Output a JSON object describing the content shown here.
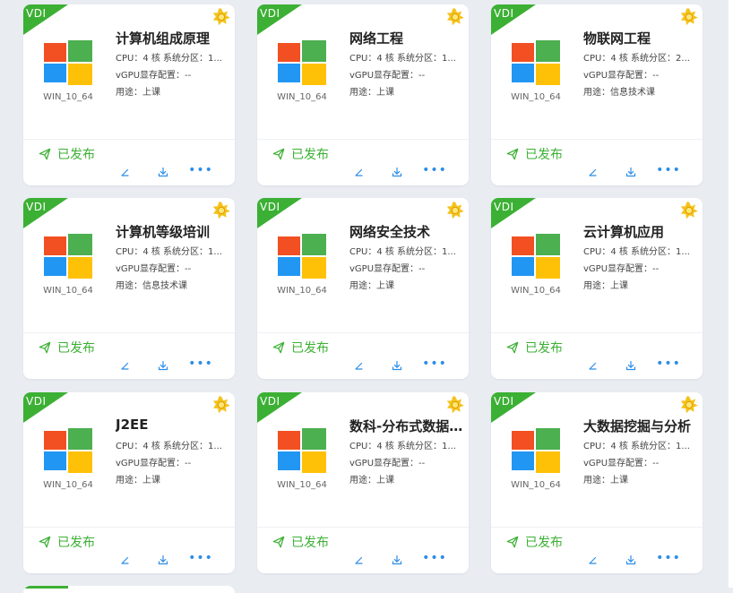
{
  "cards": [
    {
      "badge": "VDI",
      "title": "计算机组成原理",
      "os": "WIN_10_64",
      "cpu": "CPU：4 核    系统分区：1...",
      "vgpu": "vGPU显存配置：--",
      "usage": "用途：上课",
      "status": "已发布"
    },
    {
      "badge": "VDI",
      "title": "网络工程",
      "os": "WIN_10_64",
      "cpu": "CPU：4 核    系统分区：1...",
      "vgpu": "vGPU显存配置：--",
      "usage": "用途：上课",
      "status": "已发布"
    },
    {
      "badge": "VDI",
      "title": "物联网工程",
      "os": "WIN_10_64",
      "cpu": "CPU：4 核    系统分区：2...",
      "vgpu": "vGPU显存配置：--",
      "usage": "用途：信息技术课",
      "status": "已发布"
    },
    {
      "badge": "VDI",
      "title": "计算机等级培训",
      "os": "WIN_10_64",
      "cpu": "CPU：4 核    系统分区：1...",
      "vgpu": "vGPU显存配置：--",
      "usage": "用途：信息技术课",
      "status": "已发布"
    },
    {
      "badge": "VDI",
      "title": "网络安全技术",
      "os": "WIN_10_64",
      "cpu": "CPU：4 核    系统分区：1...",
      "vgpu": "vGPU显存配置：--",
      "usage": "用途：上课",
      "status": "已发布"
    },
    {
      "badge": "VDI",
      "title": "云计算机应用",
      "os": "WIN_10_64",
      "cpu": "CPU：4 核    系统分区：1...",
      "vgpu": "vGPU显存配置：--",
      "usage": "用途：上课",
      "status": "已发布"
    },
    {
      "badge": "VDI",
      "title": "J2EE",
      "os": "WIN_10_64",
      "cpu": "CPU：4 核    系统分区：1...",
      "vgpu": "vGPU显存配置：--",
      "usage": "用途：上课",
      "status": "已发布"
    },
    {
      "badge": "VDI",
      "title": "数科-分布式数据...",
      "os": "WIN_10_64",
      "cpu": "CPU：4 核    系统分区：1...",
      "vgpu": "vGPU显存配置：--",
      "usage": "用途：上课",
      "status": "已发布"
    },
    {
      "badge": "VDI",
      "title": "大数据挖掘与分析",
      "os": "WIN_10_64",
      "cpu": "CPU：4 核    系统分区：1...",
      "vgpu": "vGPU显存配置：--",
      "usage": "用途：上课",
      "status": "已发布"
    }
  ],
  "icons": {
    "status": "send-icon",
    "edit": "edit-icon",
    "download": "download-icon",
    "more": "more-icon",
    "badge_star": "star-badge-icon",
    "os": "windows-logo-icon"
  },
  "colors": {
    "accent_green": "#3cb034",
    "link_blue": "#2b8de8",
    "win_red": "#f25022",
    "win_green": "#4caf50",
    "win_blue": "#2196f3",
    "win_yellow": "#ffc107",
    "background": "#e9edf2"
  },
  "more_label": "•••"
}
